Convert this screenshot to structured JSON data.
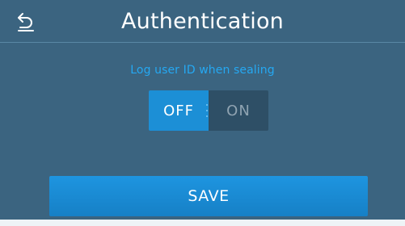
{
  "header": {
    "title": "Authentication",
    "back_icon": "back-arrow-icon"
  },
  "setting": {
    "label": "Log user ID when sealing",
    "off_label": "OFF",
    "on_label": "ON",
    "selected": "OFF"
  },
  "actions": {
    "save_label": "SAVE"
  },
  "colors": {
    "background": "#3b6480",
    "accent": "#1c8fd6",
    "label": "#25a8f2",
    "inactive_segment": "#2e4f66"
  }
}
